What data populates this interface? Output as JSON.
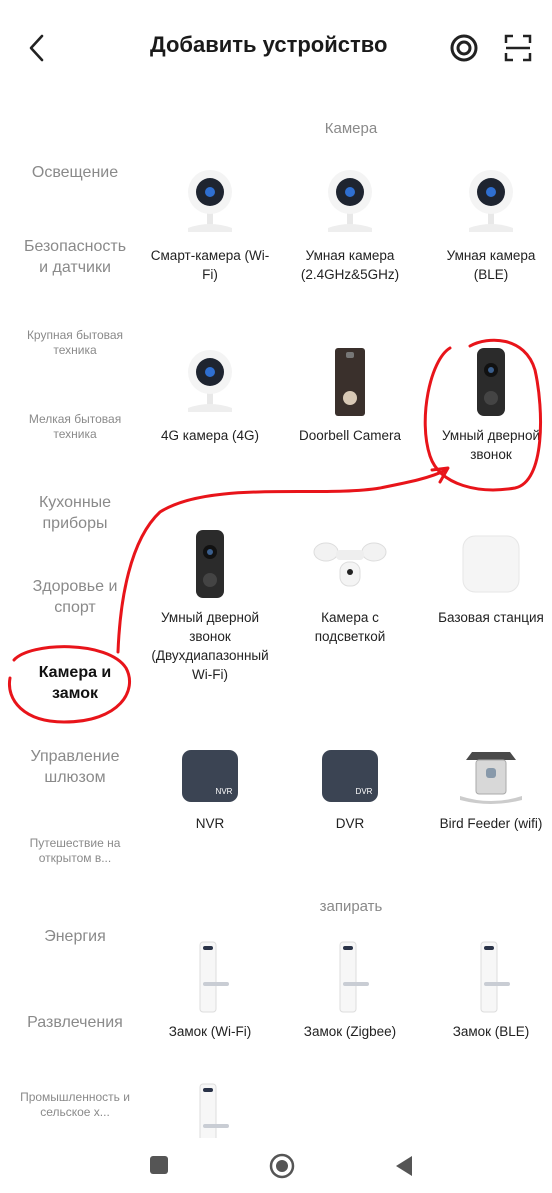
{
  "header": {
    "title": "Добавить устройство",
    "back_icon": "chevron-left-icon",
    "icons": [
      "at-sign-icon",
      "scan-icon"
    ]
  },
  "sidebar": {
    "items": [
      {
        "label": "Освещение"
      },
      {
        "label": "Безопасность и датчики"
      },
      {
        "label": "Крупная бытовая техника"
      },
      {
        "label": "Мелкая бытовая техника"
      },
      {
        "label": "Кухонные приборы"
      },
      {
        "label": "Здоровье и спорт"
      },
      {
        "label": "Камера и замок",
        "active": true
      },
      {
        "label": "Управление шлюзом"
      },
      {
        "label": "Путешествие на открытом в..."
      },
      {
        "label": "Энергия"
      },
      {
        "label": "Развлечения"
      },
      {
        "label": "Промышленность и сельское х..."
      }
    ]
  },
  "sections": [
    {
      "title": "Камера",
      "items": [
        {
          "label": "Смарт-камера (Wi-Fi)",
          "icon": "camera-icon"
        },
        {
          "label": "Умная камера (2.4GHz&5GHz)",
          "icon": "camera-icon"
        },
        {
          "label": "Умная камера (BLE)",
          "icon": "camera-icon"
        },
        {
          "label": "4G камера (4G)",
          "icon": "camera-icon"
        },
        {
          "label": "Doorbell Camera",
          "icon": "doorbell-icon"
        },
        {
          "label": "Умный дверной звонок",
          "icon": "video-doorbell-icon"
        },
        {
          "label": "Умный дверной звонок (Двухдиапазонный Wi-Fi)",
          "icon": "video-doorbell-icon"
        },
        {
          "label": "Камера с подсветкой",
          "icon": "floodlight-camera-icon"
        },
        {
          "label": "Базовая станция",
          "icon": "base-station-icon"
        },
        {
          "label": "NVR",
          "icon": "nvr-icon",
          "badge": "NVR"
        },
        {
          "label": "DVR",
          "icon": "dvr-icon",
          "badge": "DVR"
        },
        {
          "label": "Bird Feeder (wifi)",
          "icon": "bird-feeder-icon"
        }
      ]
    },
    {
      "title": "запирать",
      "items": [
        {
          "label": "Замок (Wi-Fi)",
          "icon": "lock-icon"
        },
        {
          "label": "Замок (Zigbee)",
          "icon": "lock-icon"
        },
        {
          "label": "Замок (BLE)",
          "icon": "lock-icon"
        },
        {
          "label": "",
          "icon": "lock-icon"
        }
      ]
    }
  ],
  "navbar": {
    "icons": [
      "recent-apps-icon",
      "home-icon",
      "back-icon"
    ]
  },
  "colors": {
    "annotation": "#e8141a",
    "camera_lens": "#2f6fd1"
  }
}
